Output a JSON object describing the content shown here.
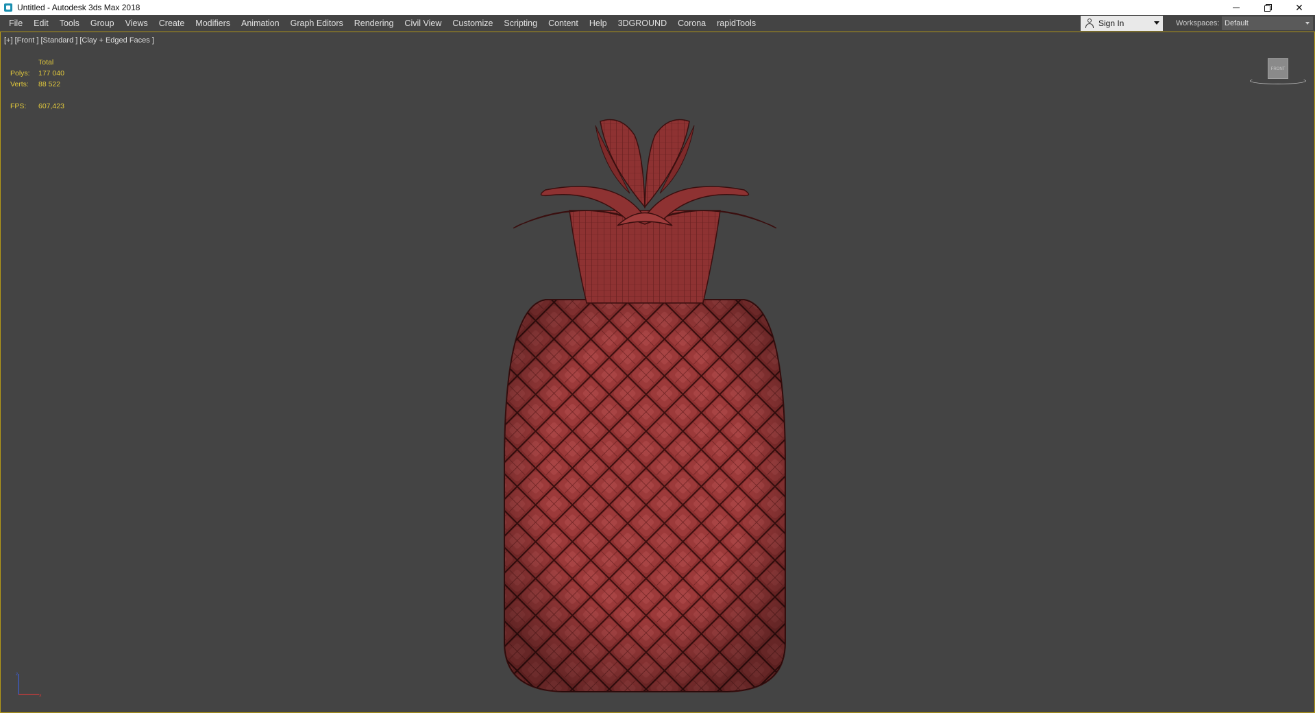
{
  "window": {
    "title": "Untitled - Autodesk 3ds Max 2018"
  },
  "menu": {
    "items": [
      "File",
      "Edit",
      "Tools",
      "Group",
      "Views",
      "Create",
      "Modifiers",
      "Animation",
      "Graph Editors",
      "Rendering",
      "Civil View",
      "Customize",
      "Scripting",
      "Content",
      "Help",
      "3DGROUND",
      "Corona",
      "rapidTools"
    ]
  },
  "account": {
    "sign_in_label": "Sign In"
  },
  "workspaces": {
    "label": "Workspaces:",
    "selected": "Default"
  },
  "viewport": {
    "label": "[+] [Front ] [Standard ] [Clay + Edged Faces ]",
    "viewcube_face": "FRONT",
    "stats": {
      "header": "Total",
      "polys_label": "Polys:",
      "polys_value": "177 040",
      "verts_label": "Verts:",
      "verts_value": "88 522",
      "fps_label": "FPS:",
      "fps_value": "607,423"
    }
  },
  "colors": {
    "viewport_bg": "#444444",
    "model_clay": "#8e3232",
    "stats_text": "#e2c93c",
    "active_border": "#b59a16"
  }
}
